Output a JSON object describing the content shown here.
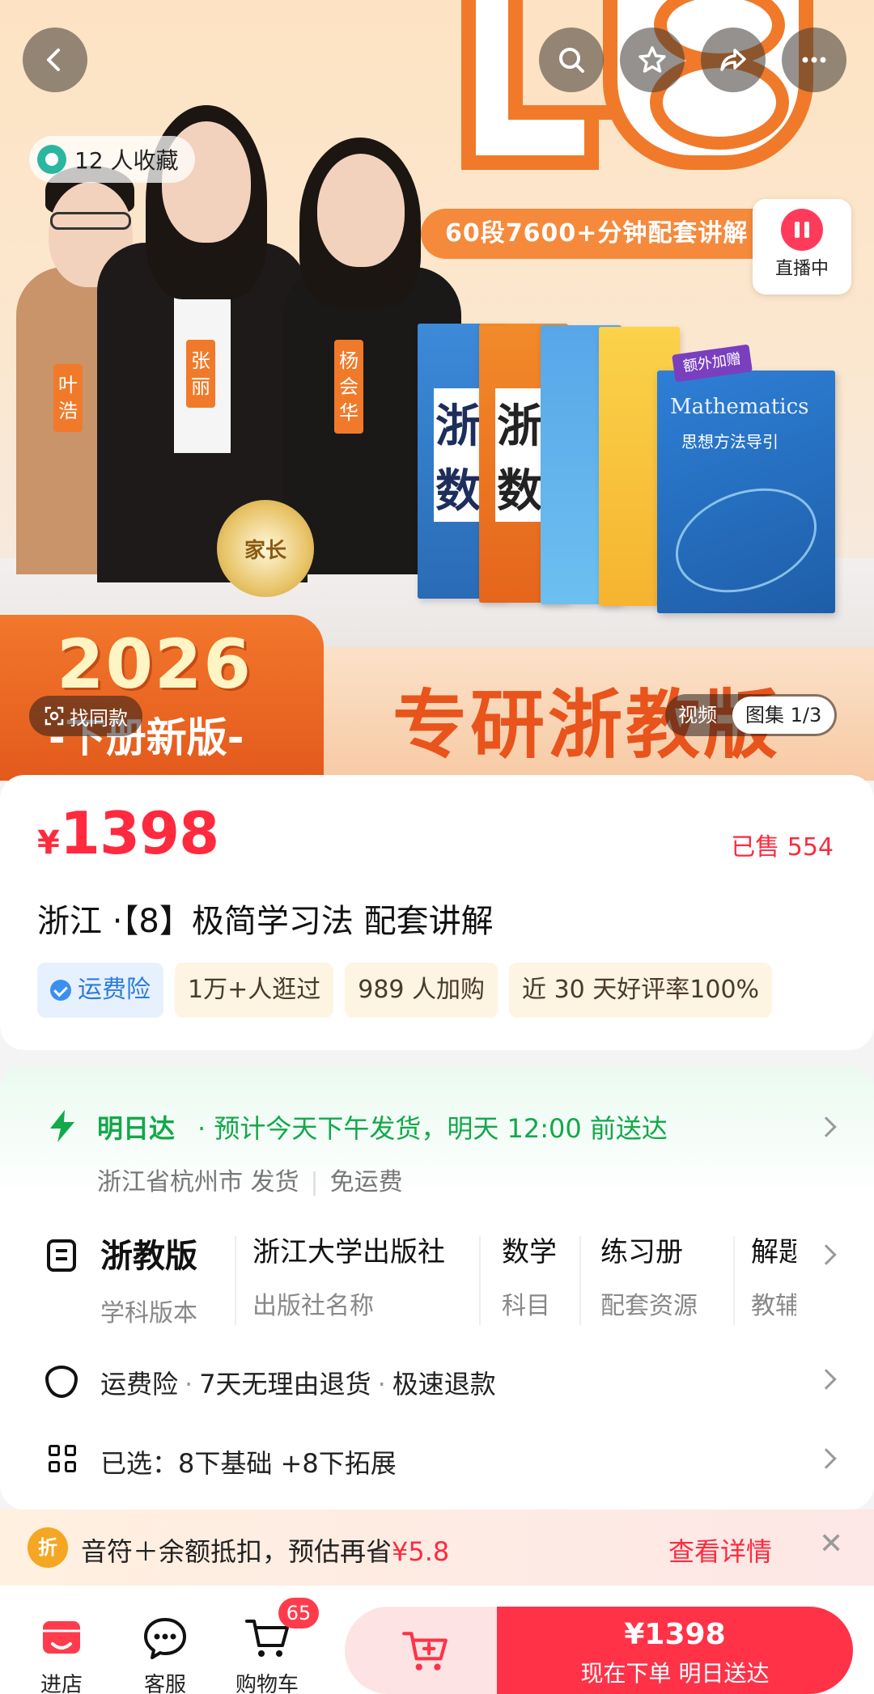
{
  "hero": {
    "favorites": "12 人收藏",
    "promo_strip": "60段7600+分钟配套讲解",
    "live_label": "直播中",
    "teachers": [
      "叶浩",
      "张丽",
      "杨会华"
    ],
    "medal": "家长",
    "book_new_tag": "额外加赠",
    "book_title_en": "Mathematics",
    "book_title_cn": "思想方法导引",
    "book_chars": [
      "浙",
      "数"
    ],
    "year": "2026",
    "edition": "-下册新版-",
    "slogan": "专研浙教版",
    "find_same": "找同款",
    "media_video": "视频",
    "media_gallery": "图集 1/3"
  },
  "product": {
    "currency": "¥",
    "price": "1398",
    "sold": "已售 554",
    "title": "浙江 ·【8】极简学习法 配套讲解",
    "tags": [
      "运费险",
      "1万+人逛过",
      "989 人加购",
      "近 30 天好评率100%"
    ]
  },
  "shipping": {
    "title": "明日达",
    "desc": "· 预计今天下午发货，明天 12:00 前送达",
    "origin": "浙江省杭州市 发货",
    "free": "免运费"
  },
  "specs": [
    {
      "value": "浙教版",
      "key": "学科版本"
    },
    {
      "value": "浙江大学出版社",
      "key": "出版社名称"
    },
    {
      "value": "数学",
      "key": "科目"
    },
    {
      "value": "练习册",
      "key": "配套资源"
    },
    {
      "value": "解题",
      "key": "教辅"
    }
  ],
  "service": {
    "items": [
      "运费险",
      "7天无理由退货",
      "极速退款"
    ]
  },
  "selected": {
    "label": "已选：",
    "value": "8下基础 +8下拓展"
  },
  "coupon": {
    "icon": "折",
    "text_prefix": "音符＋余额抵扣，预估再省",
    "amount": "¥5.8",
    "link": "查看详情",
    "close": "✕"
  },
  "bottom": {
    "store": "进店",
    "service": "客服",
    "cart": "购物车",
    "cart_count": "65",
    "buy_price": "¥1398",
    "buy_label": "现在下单  明日送达"
  },
  "colors": {
    "accent": "#ff2a3e",
    "orange": "#f07a2a",
    "green": "#13a84a"
  }
}
